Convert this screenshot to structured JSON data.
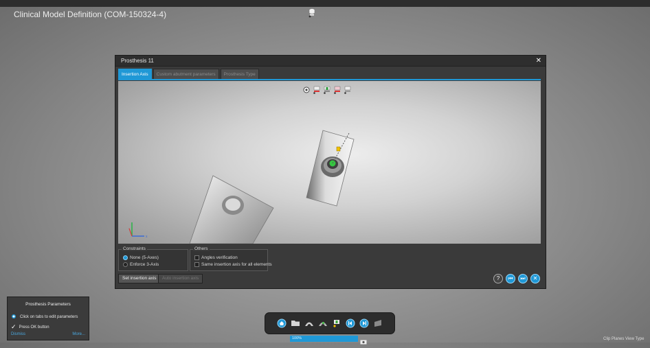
{
  "app": {
    "title": "Clinical Model Definition (COM-150324-4)"
  },
  "dialog": {
    "title": "Prosthesis 11",
    "tabs": [
      {
        "label": "Insertion Axis",
        "active": true
      },
      {
        "label": "Custom abutment parameters",
        "active": false
      },
      {
        "label": "Prosthesis Type",
        "active": false
      }
    ],
    "constraints": {
      "legend": "Constraints",
      "options": [
        {
          "label": "None (5-Axes)",
          "selected": true
        },
        {
          "label": "Enforce 3-Axis",
          "selected": false
        }
      ]
    },
    "others": {
      "legend": "Others",
      "options": [
        {
          "label": "Angles verification",
          "checked": false
        },
        {
          "label": "Same insertion axis for all elements",
          "checked": false
        }
      ]
    },
    "buttons": {
      "set_axis": "Set insertion axis",
      "auto_axis": "Auto insertion axis"
    }
  },
  "params_panel": {
    "title": "Prosthesis Parameters",
    "hint1": "Click on tabs to edit parameters",
    "hint2": "Press OK button",
    "dismiss": "Dismiss",
    "more": "More..."
  },
  "status": {
    "progress_label": "100%",
    "progress_fraction": 1.0,
    "bottom_right": "Clip Planes   View Type"
  },
  "colors": {
    "accent": "#1f98d6",
    "dialog_bg": "#3a3a3a",
    "panel_bg": "#3b3b3b"
  }
}
